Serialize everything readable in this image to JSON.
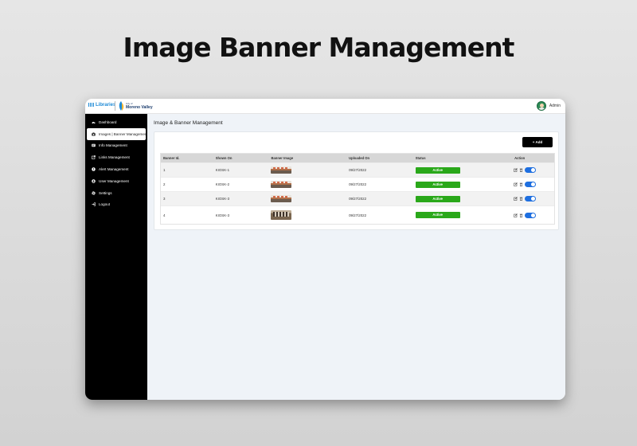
{
  "hero": {
    "title": "Image Banner Management"
  },
  "topbar": {
    "libraries_logo": "Libraries",
    "city_of": "City of",
    "city_name": "Moreno Valley",
    "admin_label": "Admin"
  },
  "sidebar": {
    "items": [
      {
        "label": "Dashboard",
        "icon": "dashboard-icon",
        "active": false
      },
      {
        "label": "Images | Banner Management",
        "icon": "camera-icon",
        "active": true
      },
      {
        "label": "Info Management",
        "icon": "info-icon",
        "active": false
      },
      {
        "label": "Links Management",
        "icon": "link-icon",
        "active": false
      },
      {
        "label": "Alert Management",
        "icon": "alert-icon",
        "active": false
      },
      {
        "label": "User Management",
        "icon": "user-icon",
        "active": false
      },
      {
        "label": "Settings",
        "icon": "gear-icon",
        "active": false
      },
      {
        "label": "Logout",
        "icon": "logout-icon",
        "active": false
      }
    ]
  },
  "main": {
    "page_title": "Image & Banner Management",
    "add_label": "+ Add",
    "table": {
      "headers": [
        "Banner Id.",
        "Shown On",
        "Banner Image",
        "Uploaded On",
        "Status",
        "Action"
      ],
      "rows": [
        {
          "id": "1",
          "shown_on": "KIOSK-1",
          "uploaded_on": "09/27/2022",
          "status": "Active",
          "toggle_on": true
        },
        {
          "id": "2",
          "shown_on": "KIOSK-2",
          "uploaded_on": "09/27/2022",
          "status": "Active",
          "toggle_on": true
        },
        {
          "id": "3",
          "shown_on": "KIOSK-3",
          "uploaded_on": "09/27/2022",
          "status": "Active",
          "toggle_on": true
        },
        {
          "id": "4",
          "shown_on": "KIOSK-3",
          "uploaded_on": "09/27/2022",
          "status": "Active",
          "toggle_on": true
        }
      ]
    }
  },
  "colors": {
    "sidebar_bg": "#000000",
    "status_active": "#2aa81a",
    "toggle_on": "#1e6fe0",
    "header_bg": "#d7d7d7",
    "main_bg": "#eff3f8"
  }
}
